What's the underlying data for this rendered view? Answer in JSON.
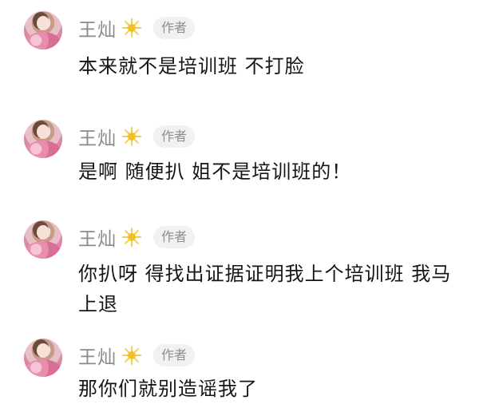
{
  "comments": [
    {
      "user": "王灿",
      "badge": "作者",
      "text": "本来就不是培训班 不打脸"
    },
    {
      "user": "王灿",
      "badge": "作者",
      "text": "是啊 随便扒 姐不是培训班的！"
    },
    {
      "user": "王灿",
      "badge": "作者",
      "text": "你扒呀 得找出证据证明我上个培训班 我马上退"
    },
    {
      "user": "王灿",
      "badge": "作者",
      "text": "那你们就别造谣我了"
    }
  ],
  "icons": {
    "verified": "sun-icon"
  },
  "colors": {
    "name": "#8a8a8a",
    "badge_bg": "#f1f1f1",
    "badge_text": "#8d8d8d",
    "text": "#151515",
    "sun": "#f3c02a"
  }
}
